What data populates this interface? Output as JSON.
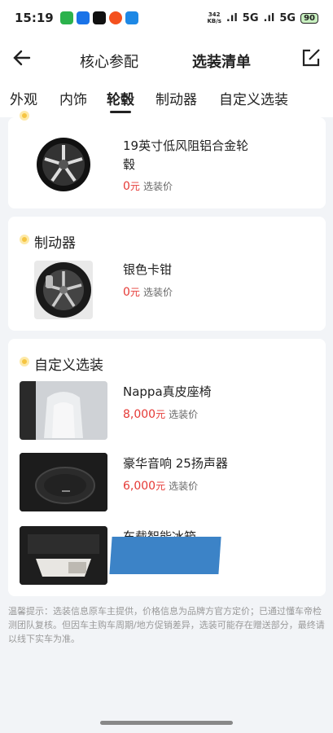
{
  "status_bar": {
    "time": "15:19",
    "net_speed_value": "342",
    "net_speed_unit": "KB/s",
    "signal1": "5G",
    "signal2": "5G",
    "battery": "90"
  },
  "nav": {
    "tab_core": "核心参配",
    "tab_options": "选装清单"
  },
  "category_tabs": [
    "外观",
    "内饰",
    "轮毂",
    "制动器",
    "自定义选装"
  ],
  "sections": {
    "wheel": {
      "item": {
        "name": "19英寸低风阻铝合金轮毂",
        "price": "0",
        "unit": "元",
        "price_label": "选装价"
      }
    },
    "brake": {
      "title": "制动器",
      "item": {
        "name": "银色卡钳",
        "price": "0",
        "unit": "元",
        "price_label": "选装价"
      }
    },
    "custom": {
      "title": "自定义选装",
      "items": [
        {
          "name": "Nappa真皮座椅",
          "price": "8,000",
          "unit": "元",
          "price_label": "选装价"
        },
        {
          "name": "豪华音响 25扬声器",
          "price": "6,000",
          "unit": "元",
          "price_label": "选装价"
        },
        {
          "name": "车载智能冰箱"
        }
      ]
    }
  },
  "footer_note": "温馨提示：选装信息原车主提供，价格信息为品牌方官方定价；已通过懂车帝检测团队复核。但因车主购车周期/地方促销差异，选装可能存在赠送部分，最终请以线下实车为准。",
  "colors": {
    "accent_yellow": "#f5c542",
    "price_red": "#e53935"
  }
}
